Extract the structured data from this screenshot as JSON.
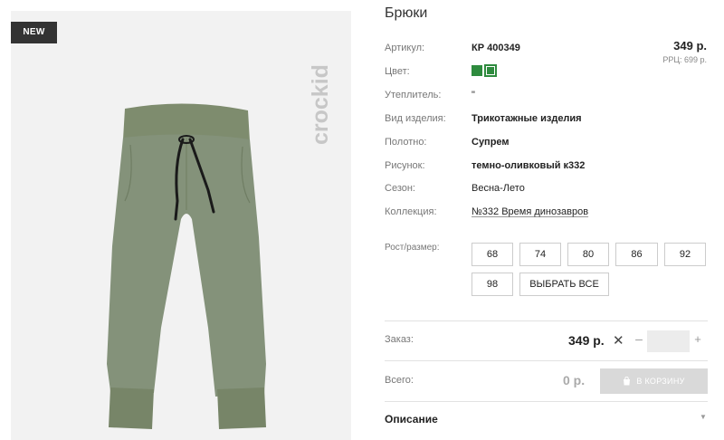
{
  "badge": "NEW",
  "brand": "crockid",
  "product": {
    "title": "Брюки",
    "price": "349 р.",
    "rrp": "РРЦ: 699 р.",
    "specs": [
      {
        "key": "Артикул:",
        "value": "КР 400349"
      },
      {
        "key": "Цвет:",
        "value": ""
      },
      {
        "key": "Утеплитель:",
        "value": "\""
      },
      {
        "key": "Вид изделия:",
        "value": "Трикотажные изделия"
      },
      {
        "key": "Полотно:",
        "value": "Супрем"
      },
      {
        "key": "Рисунок:",
        "value": "темно-оливковый к332"
      },
      {
        "key": "Сезон:",
        "value": "Весна-Лето"
      },
      {
        "key": "Коллекция:",
        "value": "№332 Время динозавров"
      }
    ],
    "colors": [
      "#2e8b3e",
      "#2e8b3e"
    ]
  },
  "sizes": {
    "label": "Рост/размер:",
    "options": [
      "68",
      "74",
      "80",
      "86",
      "92",
      "98"
    ],
    "select_all": "ВЫБРАТЬ ВСЕ"
  },
  "order": {
    "label": "Заказ:",
    "price": "349 р.",
    "times": "✕",
    "minus": "–",
    "plus": "+",
    "quantity": ""
  },
  "total": {
    "label": "Всего:",
    "value": "0 р.",
    "cart_button": "В КОРЗИНУ"
  },
  "description": {
    "label": "Описание"
  }
}
